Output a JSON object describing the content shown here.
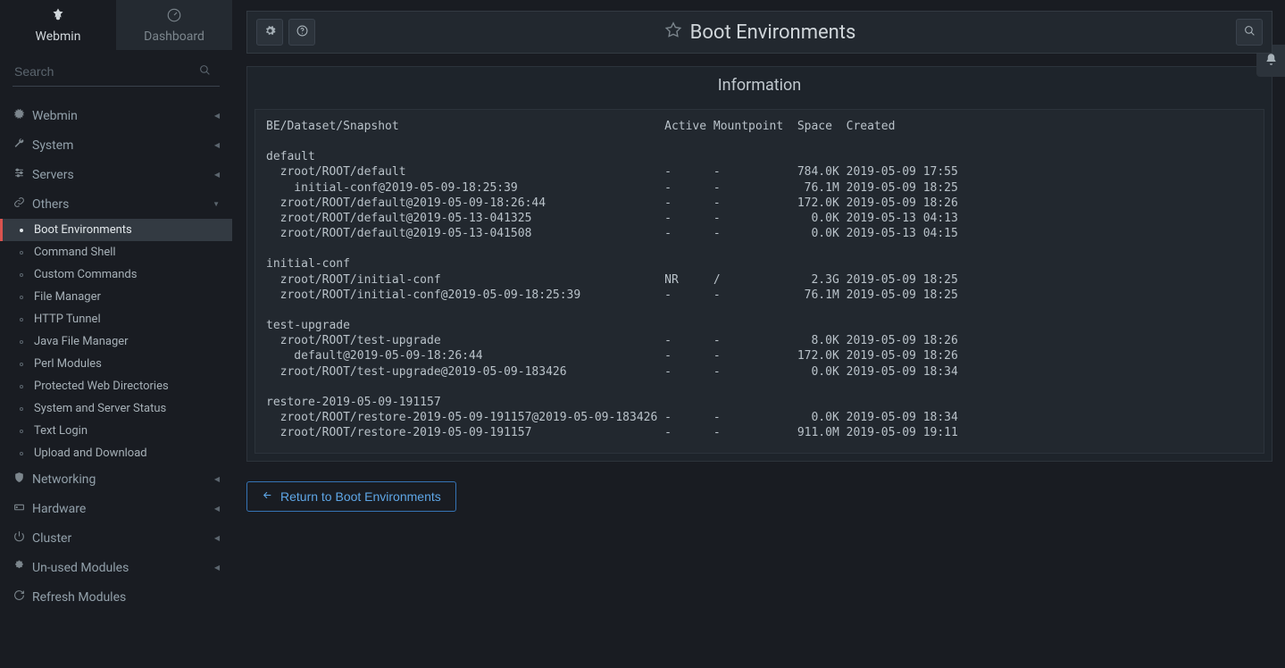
{
  "sidebar": {
    "tabs": [
      {
        "label": "Webmin",
        "active": true
      },
      {
        "label": "Dashboard",
        "active": false
      }
    ],
    "search_placeholder": "Search",
    "sections": [
      {
        "icon": "gear",
        "label": "Webmin",
        "expanded": false
      },
      {
        "icon": "wrench",
        "label": "System",
        "expanded": false
      },
      {
        "icon": "sliders",
        "label": "Servers",
        "expanded": false
      },
      {
        "icon": "link",
        "label": "Others",
        "expanded": true,
        "items": [
          {
            "label": "Boot Environments",
            "active": true
          },
          {
            "label": "Command Shell"
          },
          {
            "label": "Custom Commands"
          },
          {
            "label": "File Manager"
          },
          {
            "label": "HTTP Tunnel"
          },
          {
            "label": "Java File Manager"
          },
          {
            "label": "Perl Modules"
          },
          {
            "label": "Protected Web Directories"
          },
          {
            "label": "System and Server Status"
          },
          {
            "label": "Text Login"
          },
          {
            "label": "Upload and Download"
          }
        ]
      },
      {
        "icon": "shield",
        "label": "Networking",
        "expanded": false
      },
      {
        "icon": "hdd",
        "label": "Hardware",
        "expanded": false
      },
      {
        "icon": "power",
        "label": "Cluster",
        "expanded": false
      },
      {
        "icon": "puzzle",
        "label": "Un-used Modules",
        "expanded": false
      },
      {
        "icon": "refresh",
        "label": "Refresh Modules",
        "noitems": true
      }
    ]
  },
  "header": {
    "title": "Boot Environments"
  },
  "panel": {
    "title": "Information",
    "columns": [
      "BE/Dataset/Snapshot",
      "Active",
      "Mountpoint",
      "Space",
      "Created"
    ],
    "groups": [
      {
        "name": "default",
        "rows": [
          {
            "path": "zroot/ROOT/default",
            "indent": 1,
            "active": "-",
            "mount": "-",
            "space": "784.0K",
            "created": "2019-05-09 17:55"
          },
          {
            "path": "initial-conf@2019-05-09-18:25:39",
            "indent": 2,
            "active": "-",
            "mount": "-",
            "space": "76.1M",
            "created": "2019-05-09 18:25"
          },
          {
            "path": "zroot/ROOT/default@2019-05-09-18:26:44",
            "indent": 1,
            "active": "-",
            "mount": "-",
            "space": "172.0K",
            "created": "2019-05-09 18:26"
          },
          {
            "path": "zroot/ROOT/default@2019-05-13-041325",
            "indent": 1,
            "active": "-",
            "mount": "-",
            "space": "0.0K",
            "created": "2019-05-13 04:13"
          },
          {
            "path": "zroot/ROOT/default@2019-05-13-041508",
            "indent": 1,
            "active": "-",
            "mount": "-",
            "space": "0.0K",
            "created": "2019-05-13 04:15"
          }
        ]
      },
      {
        "name": "initial-conf",
        "rows": [
          {
            "path": "zroot/ROOT/initial-conf",
            "indent": 1,
            "active": "NR",
            "mount": "/",
            "space": "2.3G",
            "created": "2019-05-09 18:25"
          },
          {
            "path": "zroot/ROOT/initial-conf@2019-05-09-18:25:39",
            "indent": 1,
            "active": "-",
            "mount": "-",
            "space": "76.1M",
            "created": "2019-05-09 18:25"
          }
        ]
      },
      {
        "name": "test-upgrade",
        "rows": [
          {
            "path": "zroot/ROOT/test-upgrade",
            "indent": 1,
            "active": "-",
            "mount": "-",
            "space": "8.0K",
            "created": "2019-05-09 18:26"
          },
          {
            "path": "default@2019-05-09-18:26:44",
            "indent": 2,
            "active": "-",
            "mount": "-",
            "space": "172.0K",
            "created": "2019-05-09 18:26"
          },
          {
            "path": "zroot/ROOT/test-upgrade@2019-05-09-183426",
            "indent": 1,
            "active": "-",
            "mount": "-",
            "space": "0.0K",
            "created": "2019-05-09 18:34"
          }
        ]
      },
      {
        "name": "restore-2019-05-09-191157",
        "rows": [
          {
            "path": "zroot/ROOT/restore-2019-05-09-191157@2019-05-09-183426",
            "indent": 1,
            "active": "-",
            "mount": "-",
            "space": "0.0K",
            "created": "2019-05-09 18:34"
          },
          {
            "path": "zroot/ROOT/restore-2019-05-09-191157",
            "indent": 1,
            "active": "-",
            "mount": "-",
            "space": "911.0M",
            "created": "2019-05-09 19:11"
          }
        ]
      }
    ]
  },
  "return_button": "Return to Boot Environments"
}
